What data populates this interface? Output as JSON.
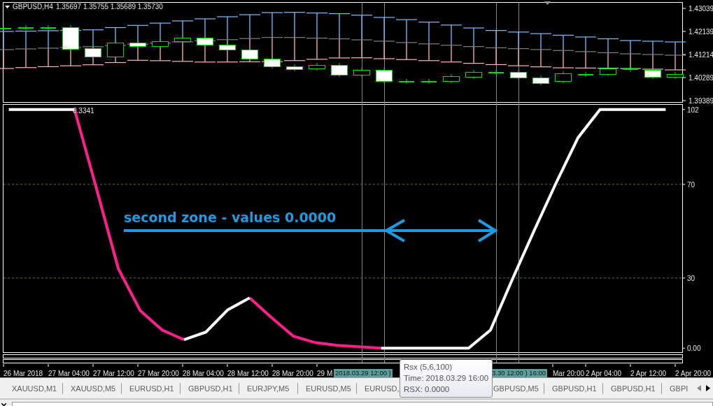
{
  "chart": {
    "symbol": "GBPUSD,H4",
    "ohlc": [
      "1.35697",
      "1.35755",
      "1.35689",
      "1.35730"
    ],
    "price_axis": [
      "1.43039",
      "1.42139",
      "1.41214",
      "1.40289",
      "1.39389"
    ]
  },
  "indicator": {
    "value": "0.3341",
    "chart_data": {
      "type": "line",
      "ylim": [
        -2,
        104
      ],
      "yticks": [
        {
          "value": 0,
          "label": "0.00"
        },
        30,
        70,
        102
      ],
      "categories": [
        null,
        null,
        null,
        null,
        null,
        null,
        null,
        null,
        null,
        null,
        null,
        null,
        null,
        null,
        null,
        null,
        null,
        null,
        null,
        null,
        null,
        null,
        null,
        null,
        null,
        null,
        null,
        null,
        null,
        null,
        null
      ],
      "series": [
        {
          "color": "#ff1f8c",
          "values": [
            null,
            null,
            null,
            102,
            68.3,
            34,
            16.1,
            7.8,
            3.6,
            null,
            null,
            21.5,
            13.1,
            5.1,
            2.4,
            1.2,
            0.6,
            0,
            null,
            null,
            null,
            null,
            null,
            null,
            null,
            null,
            null,
            null,
            null,
            null,
            null
          ]
        },
        {
          "color": "#ffffff",
          "values": [
            102,
            102,
            102,
            102,
            null,
            null,
            null,
            null,
            3.6,
            6.9,
            16.4,
            21.5,
            null,
            null,
            null,
            null,
            null,
            0,
            0,
            0,
            0,
            0,
            7.8,
            29.5,
            50.4,
            70.7,
            90,
            102,
            102,
            102,
            102
          ]
        }
      ]
    }
  },
  "annotation": "second zone - values 0.0000",
  "time_axis": [
    {
      "label": "26 Mar 2018",
      "kind": "tick"
    },
    {
      "label": "27 Mar 04:00",
      "kind": "tick"
    },
    {
      "label": "27 Mar 12:00",
      "kind": "tick"
    },
    {
      "label": "27 Mar 20:00",
      "kind": "tick"
    },
    {
      "label": "28 Mar 04:00",
      "kind": "tick"
    },
    {
      "label": "28 Mar 12:00",
      "kind": "tick"
    },
    {
      "label": "28 Mar 20:00",
      "kind": "tick"
    },
    {
      "label": "29 M",
      "kind": "tick"
    },
    {
      "label": "2018.03.29 12:00 )",
      "kind": "crosshair"
    },
    {
      "label": "3.30 12:00 ) 16:00",
      "kind": "crosshair"
    },
    {
      "label": "Mar 20:00",
      "kind": "tick"
    },
    {
      "label": "2 Apr 04:00",
      "kind": "tick"
    },
    {
      "label": "2 Apr 12:00",
      "kind": "tick"
    },
    {
      "label": "2 Apr 20:00",
      "kind": "tick"
    }
  ],
  "tooltip": [
    "Rsx (5,6,100)",
    "Time: 2018.03.29 16:00",
    "RSX: 0.0000"
  ],
  "tabs": [
    {
      "label": "XAUUSD,M1",
      "selected": false
    },
    {
      "label": "XAUUSD,M5",
      "selected": false
    },
    {
      "label": "EURUSD,H1",
      "selected": false
    },
    {
      "label": "GBPUSD,H1",
      "selected": false
    },
    {
      "label": "EURJPY,M5",
      "selected": false
    },
    {
      "label": "EURUSD,M5",
      "selected": false
    },
    {
      "label": "EURUSD,",
      "selected": false
    },
    {
      "label": "GBPUSD,M5",
      "selected": false
    },
    {
      "label": "GBPUSD,H1",
      "selected": false
    },
    {
      "label": "GBPUSD,H1",
      "selected": false
    },
    {
      "label": "GBPI",
      "selected": false
    }
  ]
}
